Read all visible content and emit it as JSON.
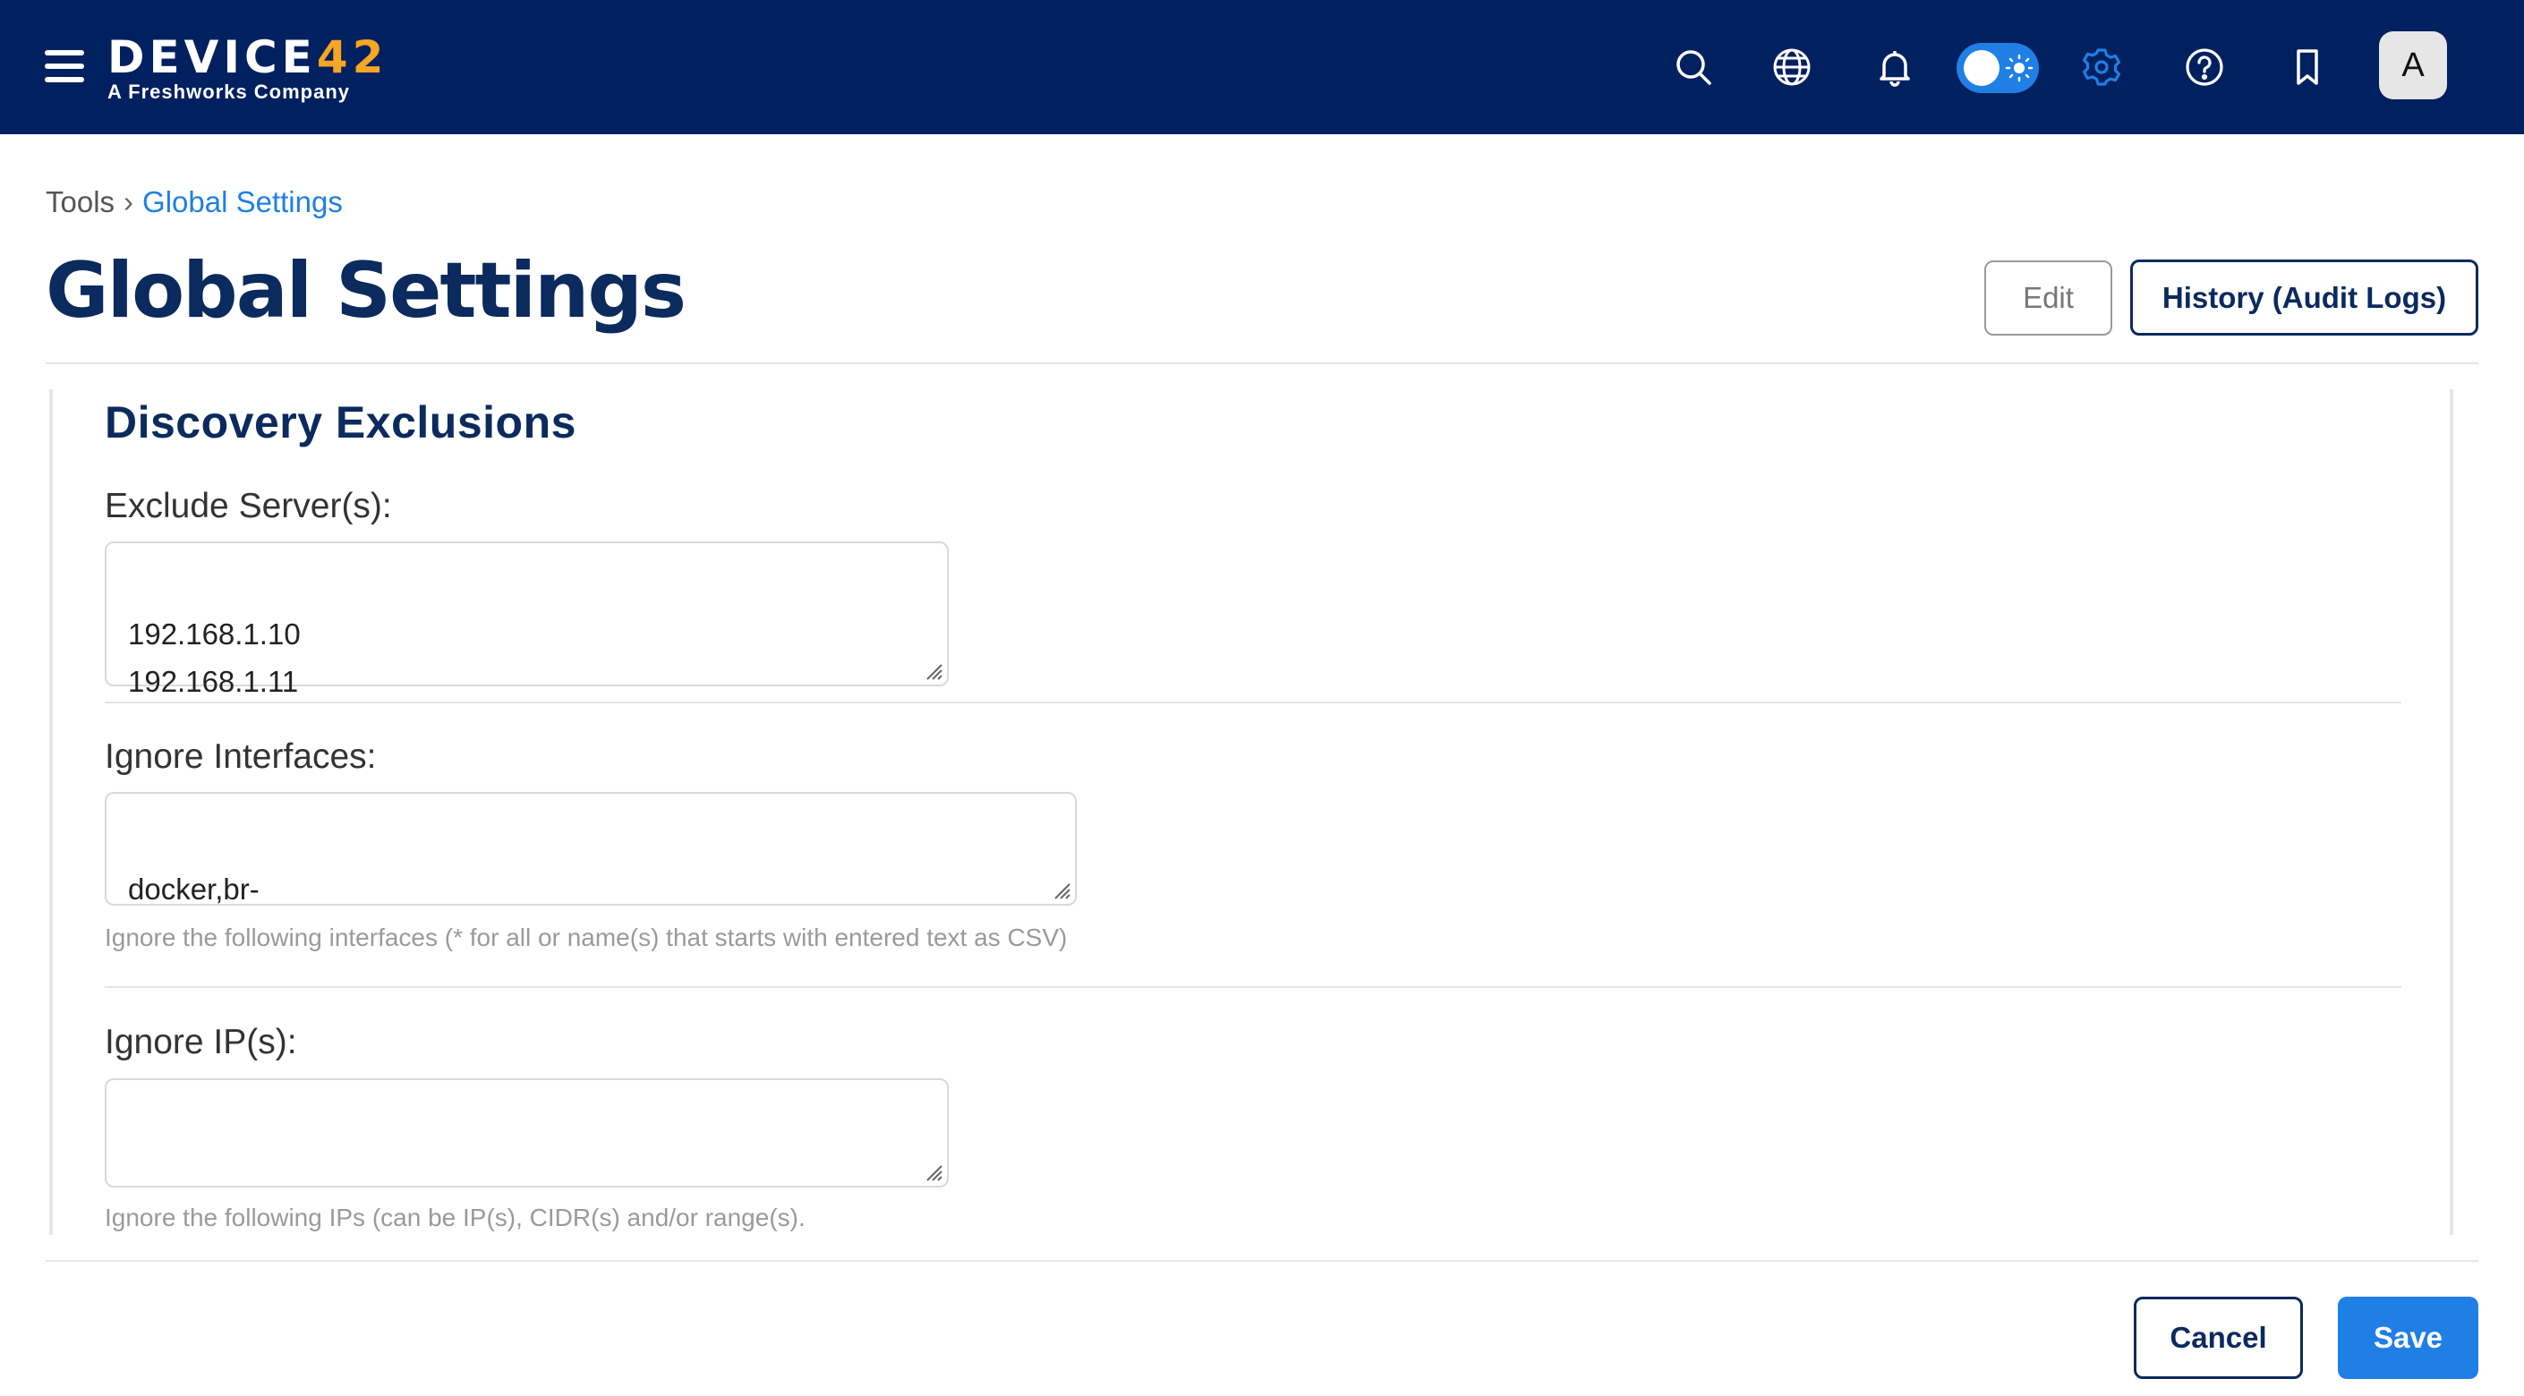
{
  "app": {
    "logo_prefix": "DEVICE",
    "logo_accent": "42",
    "logo_subtitle": "A Freshworks Company",
    "avatar_initial": "A",
    "colors": {
      "navbar": "#002060",
      "brand_accent": "#f5a623",
      "primary": "#1f7fe5",
      "title": "#0b2a5e"
    }
  },
  "topbar": {
    "icons": [
      "menu-icon",
      "search-icon",
      "globe-icon",
      "bell-icon",
      "theme-toggle",
      "gear-icon",
      "help-icon",
      "bookmark-icon",
      "avatar"
    ]
  },
  "breadcrumb": {
    "root": "Tools",
    "separator": "›",
    "current": "Global Settings"
  },
  "page": {
    "title": "Global Settings",
    "edit_label": "Edit",
    "history_label": "History (Audit Logs)"
  },
  "section": {
    "title": "Discovery Exclusions",
    "fields": [
      {
        "label": "Exclude Server(s):",
        "value": "192.168.1.10\n192.168.1.11",
        "help": ""
      },
      {
        "label": "Ignore Interfaces:",
        "value": "docker,br-",
        "help": "Ignore the following interfaces (* for all or name(s) that starts with entered text as CSV)"
      },
      {
        "label": "Ignore IP(s):",
        "value": "",
        "help": "Ignore the following IPs (can be IP(s), CIDR(s) and/or range(s)."
      }
    ]
  },
  "footer": {
    "cancel_label": "Cancel",
    "save_label": "Save"
  }
}
